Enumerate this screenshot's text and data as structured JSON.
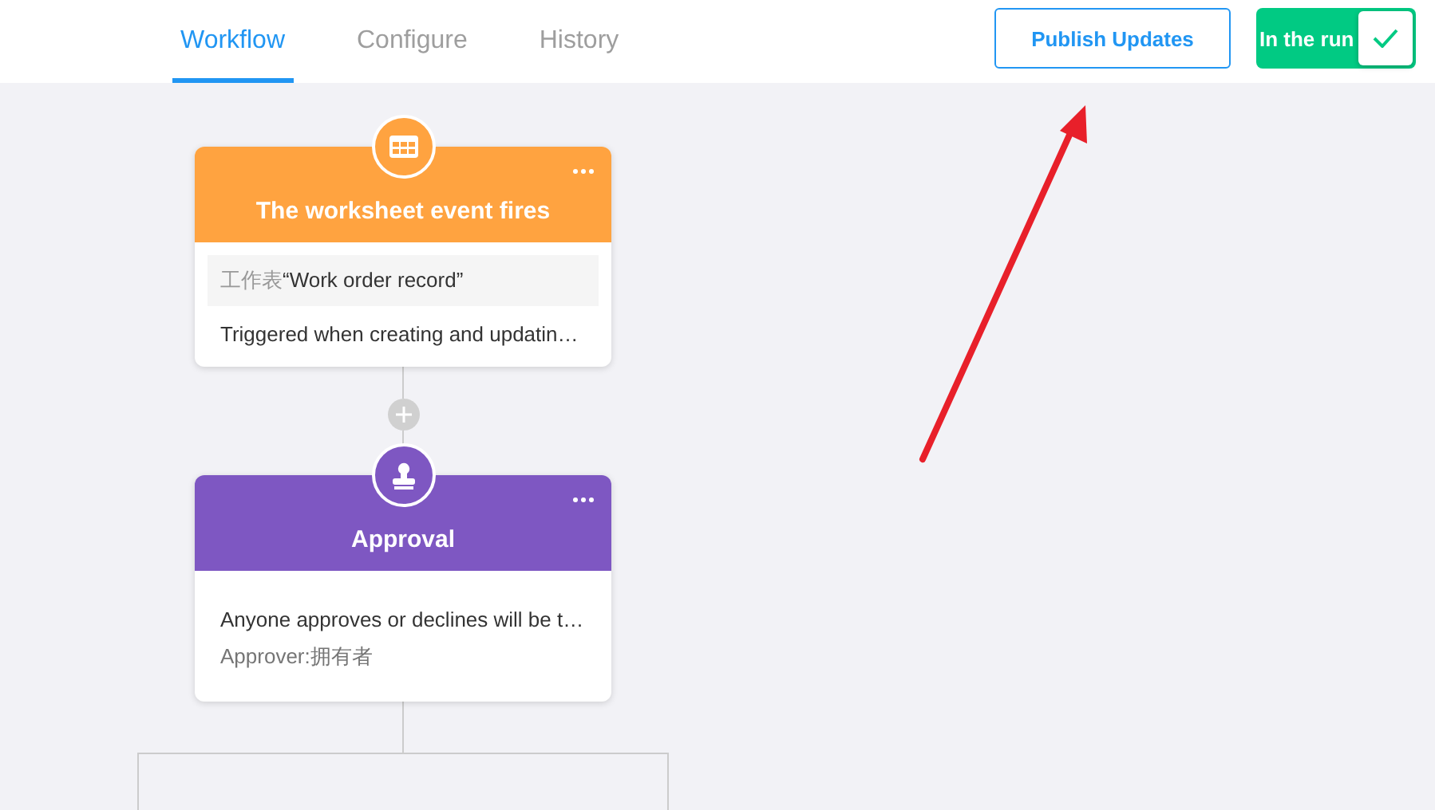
{
  "tabs": [
    {
      "label": "Workflow",
      "selected": true
    },
    {
      "label": "Configure",
      "selected": false
    },
    {
      "label": "History",
      "selected": false
    }
  ],
  "publish_button": "Publish Updates",
  "run_toggle": {
    "label": "In the run",
    "on": true
  },
  "nodes": [
    {
      "kind": "trigger",
      "title": "The worksheet event fires",
      "color": "#ffa340",
      "field": {
        "prefix": "工作表",
        "value": "“Work order record”"
      },
      "lines": [
        "Triggered when creating and updatin…"
      ]
    },
    {
      "kind": "approval",
      "title": "Approval",
      "color": "#7e57c2",
      "lines": [
        "Anyone approves or declines will be t…",
        "Approver:拥有者"
      ]
    }
  ]
}
